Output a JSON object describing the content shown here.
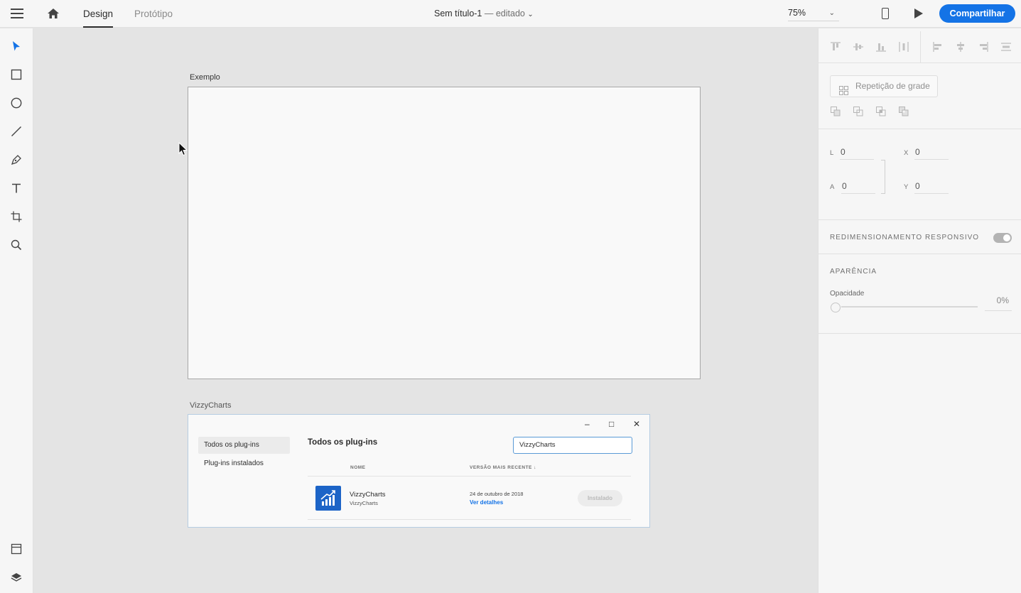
{
  "topbar": {
    "tabs": [
      "Design",
      "Protótipo"
    ],
    "doc_title": "Sem título-1",
    "doc_separator": "—",
    "doc_status": "editado",
    "zoom": "75%",
    "share_label": "Compartilhar"
  },
  "left_tools": [
    "select-tool",
    "rectangle-tool",
    "ellipse-tool",
    "line-tool",
    "pen-tool",
    "text-tool",
    "artboard-tool",
    "zoom-tool",
    "assets-panel",
    "layers-panel"
  ],
  "canvas": {
    "artboard1_label": "Exemplo",
    "artboard2_label": "VizzyCharts"
  },
  "plugin_window": {
    "window_controls": [
      "–",
      "□",
      "✕"
    ],
    "sidebar": [
      "Todos os plug-ins",
      "Plug-ins instalados"
    ],
    "title": "Todos os plug-ins",
    "search_value": "VizzyCharts",
    "col_name": "NOME",
    "col_version": "VERSÃO MAIS RECENTE ↓",
    "plugin": {
      "name": "VizzyCharts",
      "author": "VizzyCharts",
      "date": "24 de outubro de 2018",
      "details_link": "Ver detalhes",
      "status_button": "Instalado"
    }
  },
  "right_panel": {
    "repeat_grid_label": "Repetição de grade",
    "dims": {
      "w_label": "L",
      "w_value": "0",
      "h_label": "A",
      "h_value": "0",
      "x_label": "X",
      "x_value": "0",
      "y_label": "Y",
      "y_value": "0"
    },
    "responsive_label": "REDIMENSIONAMENTO RESPONSIVO",
    "responsive_on": true,
    "appearance_label": "APARÊNCIA",
    "opacity_label": "Opacidade",
    "opacity_value": "0%"
  },
  "colors": {
    "accent": "#1473e6",
    "select_tool": "#1473e6",
    "plugin_icon": "#1c64c7"
  }
}
